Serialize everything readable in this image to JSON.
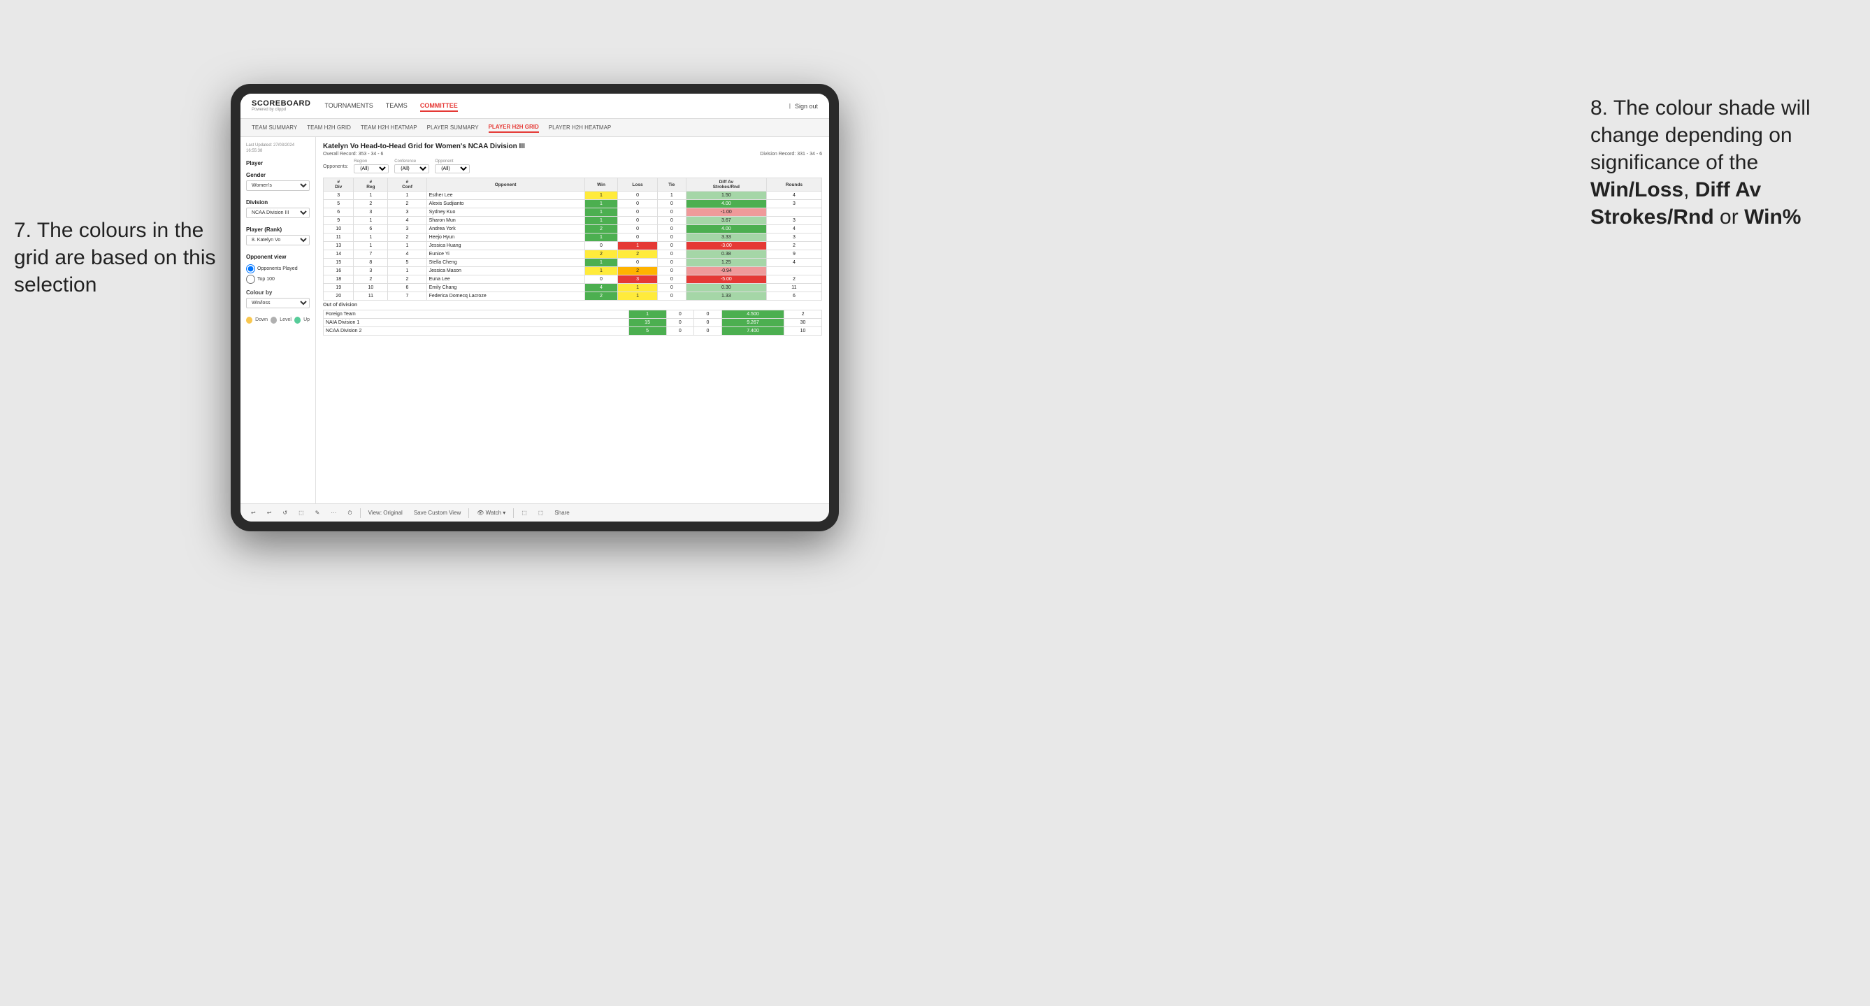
{
  "annotations": {
    "left_title": "7. The colours in the grid are based on this selection",
    "right_title": "8. The colour shade will change depending on significance of the ",
    "right_bold1": "Win/Loss",
    "right_comma1": ", ",
    "right_bold2": "Diff Av Strokes/Rnd",
    "right_or": " or ",
    "right_bold3": "Win%"
  },
  "nav": {
    "logo": "SCOREBOARD",
    "logo_sub": "Powered by clippd",
    "items": [
      "TOURNAMENTS",
      "TEAMS",
      "COMMITTEE"
    ],
    "active": "COMMITTEE",
    "right_items": [
      "Sign out"
    ]
  },
  "sub_nav": {
    "items": [
      "TEAM SUMMARY",
      "TEAM H2H GRID",
      "TEAM H2H HEATMAP",
      "PLAYER SUMMARY",
      "PLAYER H2H GRID",
      "PLAYER H2H HEATMAP"
    ],
    "active": "PLAYER H2H GRID"
  },
  "left_panel": {
    "last_updated_label": "Last Updated: 27/03/2024",
    "last_updated_time": "16:55:38",
    "player_label": "Player",
    "gender_label": "Gender",
    "gender_value": "Women's",
    "division_label": "Division",
    "division_value": "NCAA Division III",
    "player_rank_label": "Player (Rank)",
    "player_rank_value": "8. Katelyn Vo",
    "opponent_view_label": "Opponent view",
    "opponent_played": "Opponents Played",
    "top_100": "Top 100",
    "colour_by_label": "Colour by",
    "colour_by_value": "Win/loss",
    "legend": {
      "down_color": "#f9c74f",
      "level_color": "#b0b0b0",
      "up_color": "#57cc99",
      "down_label": "Down",
      "level_label": "Level",
      "up_label": "Up"
    }
  },
  "grid": {
    "title": "Katelyn Vo Head-to-Head Grid for Women's NCAA Division III",
    "overall_record_label": "Overall Record:",
    "overall_record": "353 - 34 - 6",
    "division_record_label": "Division Record:",
    "division_record": "331 - 34 - 6",
    "filters": {
      "opponents_label": "Opponents:",
      "region_label": "Region",
      "region_value": "(All)",
      "conference_label": "Conference",
      "conference_value": "(All)",
      "opponent_label": "Opponent",
      "opponent_value": "(All)"
    },
    "table_headers": [
      "#\nDiv",
      "#\nReg",
      "#\nConf",
      "Opponent",
      "Win",
      "Loss",
      "Tie",
      "Diff Av\nStrokes/Rnd",
      "Rounds"
    ],
    "rows": [
      {
        "div": "3",
        "reg": "1",
        "conf": "1",
        "opponent": "Esther Lee",
        "win": "1",
        "loss": "0",
        "tie": "1",
        "diff": "1.50",
        "rounds": "4",
        "win_color": "bg-yellow",
        "loss_color": "bg-white",
        "diff_color": "bg-green-light"
      },
      {
        "div": "5",
        "reg": "2",
        "conf": "2",
        "opponent": "Alexis Sudjianto",
        "win": "1",
        "loss": "0",
        "tie": "0",
        "diff": "4.00",
        "rounds": "3",
        "win_color": "bg-green-dark",
        "loss_color": "bg-white",
        "diff_color": "bg-green-dark"
      },
      {
        "div": "6",
        "reg": "3",
        "conf": "3",
        "opponent": "Sydney Kuo",
        "win": "1",
        "loss": "0",
        "tie": "0",
        "diff": "-1.00",
        "rounds": "",
        "win_color": "bg-green-dark",
        "loss_color": "bg-white",
        "diff_color": "bg-red-light"
      },
      {
        "div": "9",
        "reg": "1",
        "conf": "4",
        "opponent": "Sharon Mun",
        "win": "1",
        "loss": "0",
        "tie": "0",
        "diff": "3.67",
        "rounds": "3",
        "win_color": "bg-green-dark",
        "loss_color": "bg-white",
        "diff_color": "bg-green-light"
      },
      {
        "div": "10",
        "reg": "6",
        "conf": "3",
        "opponent": "Andrea York",
        "win": "2",
        "loss": "0",
        "tie": "0",
        "diff": "4.00",
        "rounds": "4",
        "win_color": "bg-green-dark",
        "loss_color": "bg-white",
        "diff_color": "bg-green-dark"
      },
      {
        "div": "11",
        "reg": "1",
        "conf": "2",
        "opponent": "Heejo Hyun",
        "win": "1",
        "loss": "0",
        "tie": "0",
        "diff": "3.33",
        "rounds": "3",
        "win_color": "bg-green-dark",
        "loss_color": "bg-white",
        "diff_color": "bg-green-light"
      },
      {
        "div": "13",
        "reg": "1",
        "conf": "1",
        "opponent": "Jessica Huang",
        "win": "0",
        "loss": "1",
        "tie": "0",
        "diff": "-3.00",
        "rounds": "2",
        "win_color": "bg-white",
        "loss_color": "bg-red-dark",
        "diff_color": "bg-red-dark"
      },
      {
        "div": "14",
        "reg": "7",
        "conf": "4",
        "opponent": "Eunice Yi",
        "win": "2",
        "loss": "2",
        "tie": "0",
        "diff": "0.38",
        "rounds": "9",
        "win_color": "bg-yellow",
        "loss_color": "bg-yellow",
        "diff_color": "bg-green-light"
      },
      {
        "div": "15",
        "reg": "8",
        "conf": "5",
        "opponent": "Stella Cheng",
        "win": "1",
        "loss": "0",
        "tie": "0",
        "diff": "1.25",
        "rounds": "4",
        "win_color": "bg-green-dark",
        "loss_color": "bg-white",
        "diff_color": "bg-green-light"
      },
      {
        "div": "16",
        "reg": "3",
        "conf": "1",
        "opponent": "Jessica Mason",
        "win": "1",
        "loss": "2",
        "tie": "0",
        "diff": "-0.94",
        "rounds": "",
        "win_color": "bg-yellow",
        "loss_color": "bg-orange",
        "diff_color": "bg-red-light"
      },
      {
        "div": "18",
        "reg": "2",
        "conf": "2",
        "opponent": "Euna Lee",
        "win": "0",
        "loss": "3",
        "tie": "0",
        "diff": "-5.00",
        "rounds": "2",
        "win_color": "bg-white",
        "loss_color": "bg-red-dark",
        "diff_color": "bg-red-dark"
      },
      {
        "div": "19",
        "reg": "10",
        "conf": "6",
        "opponent": "Emily Chang",
        "win": "4",
        "loss": "1",
        "tie": "0",
        "diff": "0.30",
        "rounds": "11",
        "win_color": "bg-green-dark",
        "loss_color": "bg-yellow",
        "diff_color": "bg-green-light"
      },
      {
        "div": "20",
        "reg": "11",
        "conf": "7",
        "opponent": "Federica Domecq Lacroze",
        "win": "2",
        "loss": "1",
        "tie": "0",
        "diff": "1.33",
        "rounds": "6",
        "win_color": "bg-green-dark",
        "loss_color": "bg-yellow",
        "diff_color": "bg-green-light"
      }
    ],
    "out_of_division_label": "Out of division",
    "ood_rows": [
      {
        "opponent": "Foreign Team",
        "win": "1",
        "loss": "0",
        "tie": "0",
        "diff": "4.500",
        "rounds": "2",
        "win_color": "bg-green-dark",
        "loss_color": "bg-white",
        "diff_color": "bg-green-dark"
      },
      {
        "opponent": "NAIA Division 1",
        "win": "15",
        "loss": "0",
        "tie": "0",
        "diff": "9.267",
        "rounds": "30",
        "win_color": "bg-green-dark",
        "loss_color": "bg-white",
        "diff_color": "bg-green-dark"
      },
      {
        "opponent": "NCAA Division 2",
        "win": "5",
        "loss": "0",
        "tie": "0",
        "diff": "7.400",
        "rounds": "10",
        "win_color": "bg-green-dark",
        "loss_color": "bg-white",
        "diff_color": "bg-green-dark"
      }
    ]
  },
  "toolbar": {
    "buttons": [
      "↩",
      "↪",
      "⟳",
      "⬚",
      "✎",
      "·",
      "⏱",
      "|",
      "View: Original",
      "Save Custom View",
      "|",
      "Watch ▾",
      "|",
      "⬚",
      "⬚",
      "Share"
    ]
  }
}
